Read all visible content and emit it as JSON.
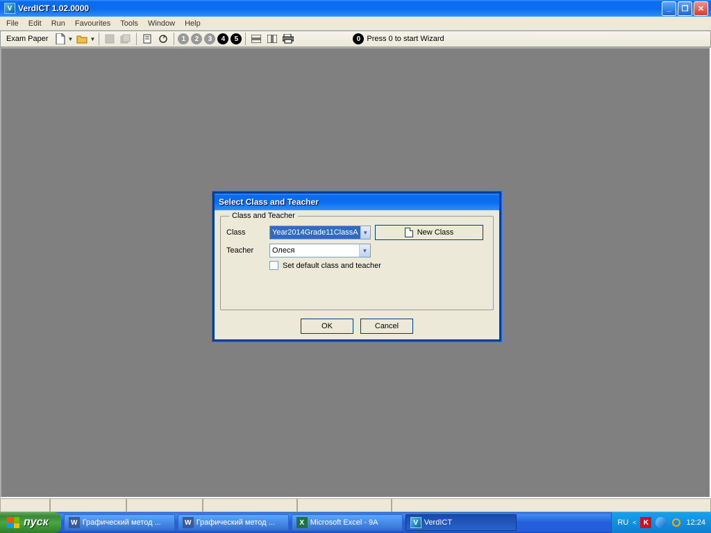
{
  "window": {
    "title": "VerdICT 1.02.0000"
  },
  "menu": {
    "file": "File",
    "edit": "Edit",
    "run": "Run",
    "favourites": "Favourites",
    "tools": "Tools",
    "window": "Window",
    "help": "Help"
  },
  "toolbar": {
    "exam_paper": "Exam Paper",
    "nums": [
      "1",
      "2",
      "3",
      "4",
      "5"
    ],
    "wizard_text": "Press 0 to start Wizard",
    "wizard_num": "0"
  },
  "dialog": {
    "title": "Select Class and Teacher",
    "legend": "Class and Teacher",
    "class_label": "Class",
    "class_value": "Year2014Grade11ClassA",
    "teacher_label": "Teacher",
    "teacher_value": "Олеся",
    "new_class": "New Class",
    "checkbox_label": "Set default class and teacher",
    "ok": "OK",
    "cancel": "Cancel"
  },
  "taskbar": {
    "start": "пуск",
    "items": [
      {
        "icon": "W",
        "label": "Графический метод ..."
      },
      {
        "icon": "W",
        "label": "Графический метод ..."
      },
      {
        "icon": "X",
        "label": "Microsoft Excel - 9A"
      },
      {
        "icon": "V",
        "label": "VerdICT"
      }
    ],
    "lang": "RU",
    "clock": "12:24"
  }
}
